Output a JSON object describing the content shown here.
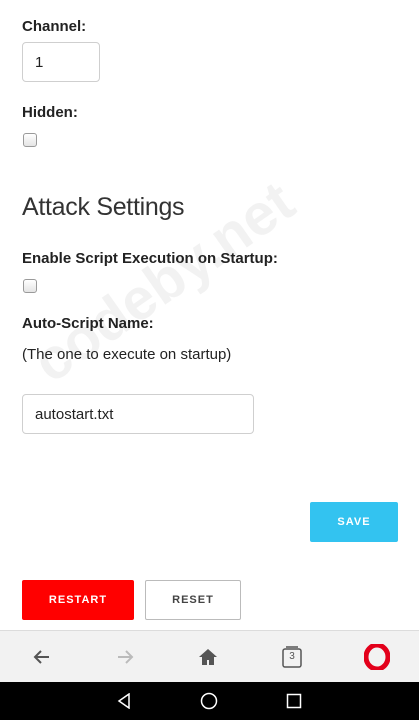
{
  "form": {
    "channel_label": "Channel:",
    "channel_value": "1",
    "hidden_label": "Hidden:",
    "attack_heading": "Attack Settings",
    "enable_script_label": "Enable Script Execution on Startup:",
    "autoscript_label": "Auto-Script Name:",
    "autoscript_hint": "(The one to execute on startup)",
    "autoscript_value": "autostart.txt"
  },
  "buttons": {
    "save": "SAVE",
    "restart": "RESTART",
    "reset": "RESET"
  },
  "watermark": "codeby.net",
  "browser": {
    "tab_count": "3",
    "icons": [
      "back-arrow-icon",
      "forward-arrow-icon",
      "home-icon",
      "tabs-icon",
      "opera-icon"
    ]
  },
  "colors": {
    "save": "#33c3f0",
    "restart": "#ff0000",
    "opera": "#e3001b"
  }
}
